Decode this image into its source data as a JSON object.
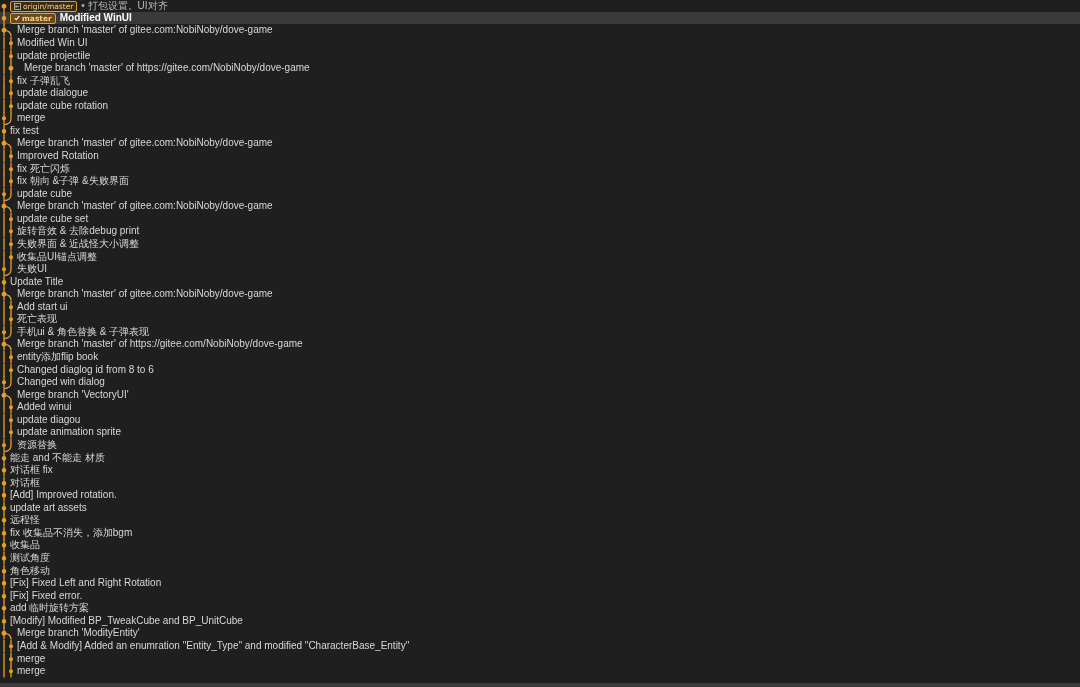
{
  "head_rows": [
    {
      "tag": "origin/master",
      "kind": "remote",
      "message": "• 打包设置。UI对齐",
      "selected": false
    },
    {
      "tag": "master",
      "kind": "local",
      "message": "Modified WinUI",
      "selected": true
    }
  ],
  "commits": [
    {
      "kind": "merge",
      "message": "Merge branch 'master' of gitee.com:NobiNoby/dove-game"
    },
    {
      "kind": "branch",
      "message": "Modified Win UI"
    },
    {
      "kind": "branch",
      "message": "update projectile"
    },
    {
      "kind": "nested",
      "message": "Merge branch 'master' of https://gitee.com/NobiNoby/dove-game"
    },
    {
      "kind": "branch",
      "message": "fix 子弹乱飞"
    },
    {
      "kind": "branch",
      "message": "update dialogue"
    },
    {
      "kind": "branch",
      "message": "update cube rotation"
    },
    {
      "kind": "last",
      "message": "merge"
    },
    {
      "kind": "main",
      "message": "fix test"
    },
    {
      "kind": "merge",
      "message": "Merge branch 'master' of gitee.com:NobiNoby/dove-game"
    },
    {
      "kind": "branch",
      "message": "Improved Rotation"
    },
    {
      "kind": "branch",
      "message": "fix 死亡闪烁"
    },
    {
      "kind": "branch",
      "message": "fix 朝向 &子弹 &失败界面"
    },
    {
      "kind": "last",
      "message": "update cube"
    },
    {
      "kind": "merge",
      "message": "Merge branch 'master' of gitee.com:NobiNoby/dove-game"
    },
    {
      "kind": "branch",
      "message": "update cube set"
    },
    {
      "kind": "branch",
      "message": "旋转音效 & 去除debug print"
    },
    {
      "kind": "branch",
      "message": "失败界面 & 近战怪大小调整"
    },
    {
      "kind": "branch",
      "message": "收集品UI锚点调整"
    },
    {
      "kind": "last",
      "message": "失败UI"
    },
    {
      "kind": "main",
      "message": "Update Title"
    },
    {
      "kind": "merge",
      "message": "Merge branch 'master' of gitee.com:NobiNoby/dove-game"
    },
    {
      "kind": "branch",
      "message": "Add start ui"
    },
    {
      "kind": "branch",
      "message": "死亡表现"
    },
    {
      "kind": "last",
      "message": "手机ui & 角色替换 & 子弹表现"
    },
    {
      "kind": "merge",
      "message": "Merge branch 'master' of https://gitee.com/NobiNoby/dove-game"
    },
    {
      "kind": "branch",
      "message": "entity添加flip book"
    },
    {
      "kind": "branch",
      "message": "Changed diaglog id from 8 to 6"
    },
    {
      "kind": "last",
      "message": "Changed win dialog"
    },
    {
      "kind": "merge",
      "message": "Merge branch 'VectoryUI'"
    },
    {
      "kind": "branch",
      "message": "Added winui"
    },
    {
      "kind": "branch",
      "message": "update diagou"
    },
    {
      "kind": "branch",
      "message": "update animation sprite"
    },
    {
      "kind": "last",
      "message": "资源替换"
    },
    {
      "kind": "main",
      "message": "能走 and 不能走 材质"
    },
    {
      "kind": "main",
      "message": "对话框 fix"
    },
    {
      "kind": "main",
      "message": "对话框"
    },
    {
      "kind": "main",
      "message": "[Add] Improved rotation."
    },
    {
      "kind": "main",
      "message": "update art assets"
    },
    {
      "kind": "main",
      "message": "远程怪"
    },
    {
      "kind": "main",
      "message": "fix 收集品不消失，添加bgm"
    },
    {
      "kind": "main",
      "message": "收集品"
    },
    {
      "kind": "main",
      "message": "测试角度"
    },
    {
      "kind": "main",
      "message": "角色移动"
    },
    {
      "kind": "main",
      "message": "[Fix] Fixed Left and Right Rotation"
    },
    {
      "kind": "main",
      "message": "[Fix] Fixed error."
    },
    {
      "kind": "main",
      "message": "add 临时旋转方案"
    },
    {
      "kind": "main",
      "message": "[Modify] Modified BP_TweakCube and BP_UnitCube"
    },
    {
      "kind": "merge",
      "message": "Merge branch 'ModityEntity'"
    },
    {
      "kind": "branch",
      "message": "[Add & Modify] Added an enumration \"Entity_Type\" and modified \"CharacterBase_Entity\""
    },
    {
      "kind": "branch",
      "message": "merge"
    },
    {
      "kind": "branch",
      "message": "merge"
    }
  ]
}
